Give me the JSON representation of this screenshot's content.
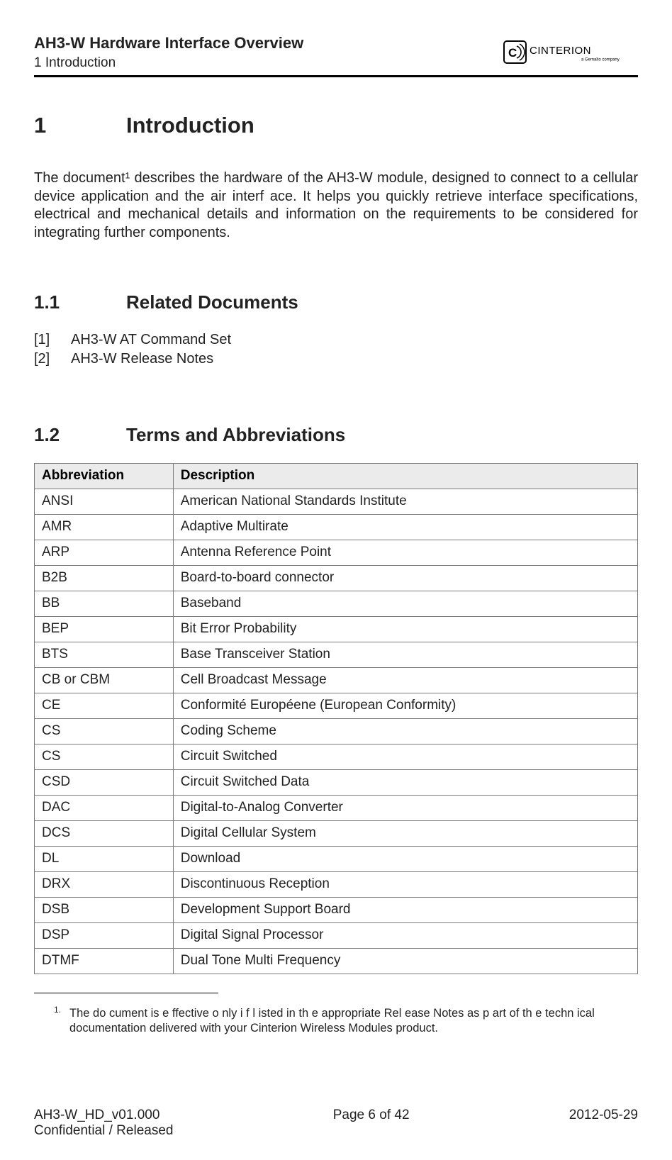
{
  "header": {
    "doc_title": "AH3-W Hardware Interface Overview",
    "section_crumb": "1 Introduction",
    "logo_wordmark": "CINTERION",
    "logo_subtext": "a Gemalto company"
  },
  "section_h1": {
    "num": "1",
    "text": "Introduction"
  },
  "intro_paragraph": "The document¹ describes the hardware of the AH3-W module, designed to connect to a cellular device application and the air interf ace. It helps you quickly retrieve interface specifications, electrical and mechanical details and information on the requirements to be considered for integrating further components.",
  "section_1_1": {
    "num": "1.1",
    "text": "Related Documents"
  },
  "related_documents": [
    {
      "ref": "[1]",
      "text": "AH3-W AT Command Set"
    },
    {
      "ref": "[2]",
      "text": "AH3-W Release Notes"
    }
  ],
  "section_1_2": {
    "num": "1.2",
    "text": "Terms and Abbreviations"
  },
  "abbrev_table": {
    "headers": {
      "col1": "Abbreviation",
      "col2": "Description"
    },
    "rows": [
      {
        "abbr": "ANSI",
        "desc": "American National Standards Institute"
      },
      {
        "abbr": "AMR",
        "desc": "Adaptive Multirate"
      },
      {
        "abbr": "ARP",
        "desc": "Antenna Reference Point"
      },
      {
        "abbr": "B2B",
        "desc": "Board-to-board connector"
      },
      {
        "abbr": "BB",
        "desc": "Baseband"
      },
      {
        "abbr": "BEP",
        "desc": "Bit Error Probability"
      },
      {
        "abbr": "BTS",
        "desc": "Base Transceiver Station"
      },
      {
        "abbr": "CB or CBM",
        "desc": "Cell Broadcast Message"
      },
      {
        "abbr": "CE",
        "desc": "Conformité Européene (European Conformity)"
      },
      {
        "abbr": "CS",
        "desc": "Coding Scheme"
      },
      {
        "abbr": "CS",
        "desc": "Circuit Switched"
      },
      {
        "abbr": "CSD",
        "desc": "Circuit Switched Data"
      },
      {
        "abbr": "DAC",
        "desc": "Digital-to-Analog Converter"
      },
      {
        "abbr": "DCS",
        "desc": "Digital Cellular System"
      },
      {
        "abbr": "DL",
        "desc": "Download"
      },
      {
        "abbr": "DRX",
        "desc": "Discontinuous Reception"
      },
      {
        "abbr": "DSB",
        "desc": "Development Support Board"
      },
      {
        "abbr": "DSP",
        "desc": "Digital Signal Processor"
      },
      {
        "abbr": "DTMF",
        "desc": "Dual Tone Multi Frequency"
      }
    ]
  },
  "footnote": {
    "mark": "1.",
    "text": "The do cument is e ffective o nly i f l isted in th e appropriate Rel ease Notes as p art of th e techn ical documentation delivered with your Cinterion Wireless Modules product."
  },
  "footer": {
    "left_line1": "AH3-W_HD_v01.000",
    "left_line2": "Confidential / Released",
    "center": "Page 6 of 42",
    "right": "2012-05-29"
  }
}
